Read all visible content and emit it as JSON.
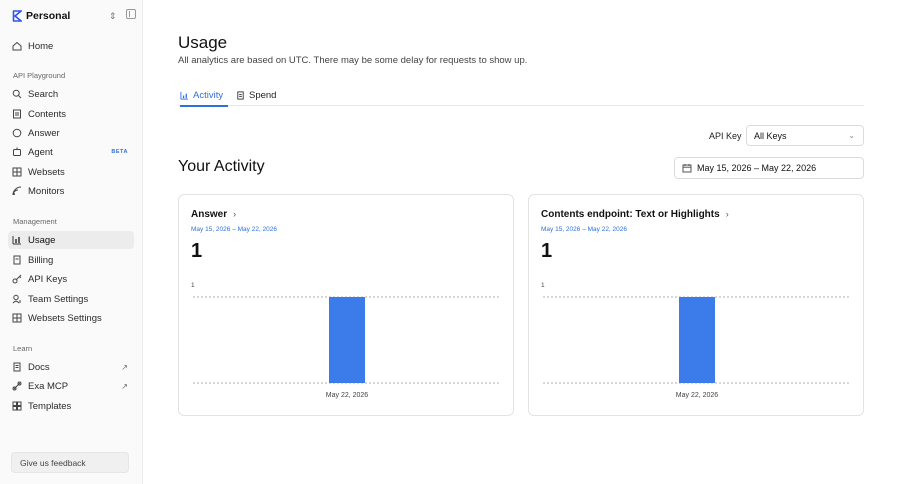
{
  "workspace": {
    "name": "Personal"
  },
  "sidebar": {
    "home": "Home",
    "sections": [
      {
        "label": "API Playground",
        "items": [
          {
            "label": "Search",
            "icon": "search-icon"
          },
          {
            "label": "Contents",
            "icon": "file-icon"
          },
          {
            "label": "Answer",
            "icon": "chat-icon"
          },
          {
            "label": "Agent",
            "icon": "agent-icon",
            "badge": "BETA"
          },
          {
            "label": "Websets",
            "icon": "grid-icon"
          },
          {
            "label": "Monitors",
            "icon": "signal-icon"
          }
        ]
      },
      {
        "label": "Management",
        "items": [
          {
            "label": "Usage",
            "icon": "bar-chart-icon",
            "active": true
          },
          {
            "label": "Billing",
            "icon": "receipt-icon"
          },
          {
            "label": "API Keys",
            "icon": "key-icon"
          },
          {
            "label": "Team Settings",
            "icon": "user-icon"
          },
          {
            "label": "Websets Settings",
            "icon": "grid-icon"
          }
        ]
      },
      {
        "label": "Learn",
        "items": [
          {
            "label": "Docs",
            "icon": "doc-icon",
            "external": true
          },
          {
            "label": "Exa MCP",
            "icon": "link-icon",
            "external": true
          },
          {
            "label": "Templates",
            "icon": "template-icon"
          }
        ]
      }
    ],
    "feedback": "Give us feedback"
  },
  "main": {
    "title": "Usage",
    "subtitle": "All analytics are based on UTC. There may be some delay for requests to show up.",
    "tabs": [
      {
        "label": "Activity",
        "active": true
      },
      {
        "label": "Spend",
        "active": false
      }
    ],
    "api_key_label": "API Key",
    "api_key_value": "All Keys",
    "section_title": "Your Activity",
    "date_range": "May 15, 2026 – May 22, 2026"
  },
  "cards": [
    {
      "title": "Answer",
      "range": "May 15, 2026 – May 22, 2026",
      "total": "1"
    },
    {
      "title": "Contents endpoint: Text or Highlights",
      "range": "May 15, 2026 – May 22, 2026",
      "total": "1"
    }
  ],
  "colors": {
    "accent": "#2f6fdb",
    "bar": "#3b7bea"
  },
  "chart_data": [
    {
      "type": "bar",
      "categories": [
        "May 22, 2026"
      ],
      "values": [
        1
      ],
      "ylim": [
        0,
        1
      ],
      "ytick_labels": [
        "1"
      ],
      "grid": "dashed-horizontal"
    },
    {
      "type": "bar",
      "categories": [
        "May 22, 2026"
      ],
      "values": [
        1
      ],
      "ylim": [
        0,
        1
      ],
      "ytick_labels": [
        "1"
      ],
      "grid": "dashed-horizontal"
    }
  ]
}
